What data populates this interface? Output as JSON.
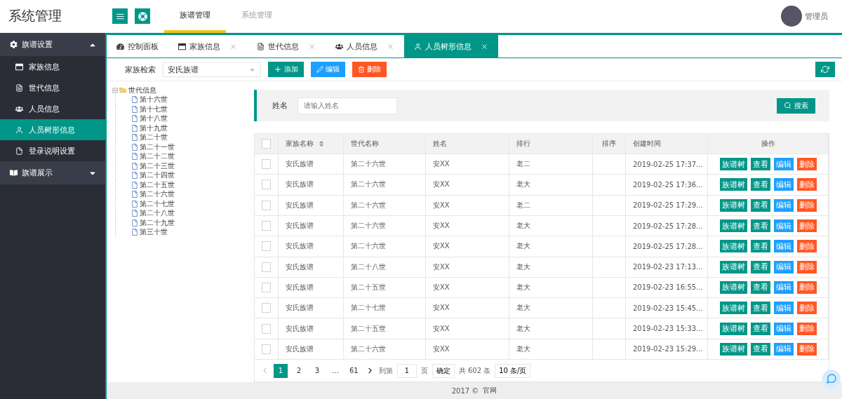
{
  "header": {
    "title": "系统管理",
    "nav": [
      {
        "label": "族谱管理",
        "selected": true
      },
      {
        "label": "系统管理",
        "selected": false
      }
    ],
    "user": "管理员"
  },
  "sidebar": [
    {
      "label": "旗谱设置",
      "expanded": true,
      "items": [
        {
          "label": "家族信息",
          "kind": "window",
          "selected": false
        },
        {
          "label": "世代信息",
          "kind": "doc",
          "selected": false
        },
        {
          "label": "人员信息",
          "kind": "users",
          "selected": false
        },
        {
          "label": "人员树形信息",
          "kind": "user",
          "selected": true
        },
        {
          "label": "登录说明设置",
          "kind": "file",
          "selected": false
        }
      ]
    },
    {
      "label": "旗谱展示",
      "expanded": false
    }
  ],
  "tabs": [
    {
      "label": "控制面板",
      "kind": "gauge",
      "closable": false,
      "selected": false
    },
    {
      "label": "家族信息",
      "kind": "window",
      "closable": true,
      "selected": false
    },
    {
      "label": "世代信息",
      "kind": "doc",
      "closable": true,
      "selected": false
    },
    {
      "label": "人员信息",
      "kind": "users",
      "closable": true,
      "selected": false
    },
    {
      "label": "人员树形信息",
      "kind": "user",
      "closable": true,
      "selected": true
    }
  ],
  "toolbar": {
    "filter_label": "家族检索",
    "filter_value": "安氏族谱",
    "buttons": [
      {
        "label": "添加",
        "kind": "add"
      },
      {
        "label": "编辑",
        "kind": "edit"
      },
      {
        "label": "删除",
        "kind": "delete"
      }
    ]
  },
  "tree": {
    "label": "世代信息",
    "expanded": true,
    "children": [
      "第十六世",
      "第十七世",
      "第十八世",
      "第十九世",
      "第二十世",
      "第二十一世",
      "第二十二世",
      "第二十三世",
      "第二十四世",
      "第二十五世",
      "第二十六世",
      "第二十七世",
      "第二十八世",
      "第二十九世",
      "第三十世"
    ]
  },
  "search": {
    "label": "姓名",
    "placeholder": "请输入姓名",
    "button": "搜索"
  },
  "table": {
    "all_checked": false,
    "columns": [
      "家族名称",
      "世代名称",
      "姓名",
      "排行",
      "排序",
      "创建时间",
      "操作"
    ],
    "rows": [
      {
        "checked": false,
        "cells": [
          "安氏族谱",
          "第二十六世",
          "安XX",
          "老二",
          "",
          "2019-02-25 17:37..."
        ],
        "actions": [
          {
            "label": "族谱树",
            "kind": "tree"
          },
          {
            "label": "查看",
            "kind": "view"
          },
          {
            "label": "编辑",
            "kind": "edit"
          },
          {
            "label": "删除",
            "kind": "delete"
          }
        ]
      },
      {
        "checked": false,
        "cells": [
          "安氏族谱",
          "第二十六世",
          "安XX",
          "老大",
          "",
          "2019-02-25 17:36..."
        ],
        "actions": [
          {
            "label": "族谱树",
            "kind": "tree"
          },
          {
            "label": "查看",
            "kind": "view"
          },
          {
            "label": "编辑",
            "kind": "edit"
          },
          {
            "label": "删除",
            "kind": "delete"
          }
        ]
      },
      {
        "checked": false,
        "cells": [
          "安氏族谱",
          "第二十六世",
          "安XX",
          "老二",
          "",
          "2019-02-25 17:29..."
        ],
        "actions": [
          {
            "label": "族谱树",
            "kind": "tree"
          },
          {
            "label": "查看",
            "kind": "view"
          },
          {
            "label": "编辑",
            "kind": "edit"
          },
          {
            "label": "删除",
            "kind": "delete"
          }
        ]
      },
      {
        "checked": false,
        "cells": [
          "安氏族谱",
          "第二十六世",
          "安XX",
          "老大",
          "",
          "2019-02-25 17:28..."
        ],
        "actions": [
          {
            "label": "族谱树",
            "kind": "tree"
          },
          {
            "label": "查看",
            "kind": "view"
          },
          {
            "label": "编辑",
            "kind": "edit"
          },
          {
            "label": "删除",
            "kind": "delete"
          }
        ]
      },
      {
        "checked": false,
        "cells": [
          "安氏族谱",
          "第二十六世",
          "安XX",
          "老大",
          "",
          "2019-02-25 17:28..."
        ],
        "actions": [
          {
            "label": "族谱树",
            "kind": "tree"
          },
          {
            "label": "查看",
            "kind": "view"
          },
          {
            "label": "编辑",
            "kind": "edit"
          },
          {
            "label": "删除",
            "kind": "delete"
          }
        ]
      },
      {
        "checked": false,
        "cells": [
          "安氏族谱",
          "第二十八世",
          "安XX",
          "老大",
          "",
          "2019-02-23 17:13..."
        ],
        "actions": [
          {
            "label": "族谱树",
            "kind": "tree"
          },
          {
            "label": "查看",
            "kind": "view"
          },
          {
            "label": "编辑",
            "kind": "edit"
          },
          {
            "label": "删除",
            "kind": "delete"
          }
        ]
      },
      {
        "checked": false,
        "cells": [
          "安氏族谱",
          "第二十五世",
          "安XX",
          "老大",
          "",
          "2019-02-23 16:55..."
        ],
        "actions": [
          {
            "label": "族谱树",
            "kind": "tree"
          },
          {
            "label": "查看",
            "kind": "view"
          },
          {
            "label": "编辑",
            "kind": "edit"
          },
          {
            "label": "删除",
            "kind": "delete"
          }
        ]
      },
      {
        "checked": false,
        "cells": [
          "安氏族谱",
          "第二十七世",
          "安XX",
          "老大",
          "",
          "2019-02-23 15:45..."
        ],
        "actions": [
          {
            "label": "族谱树",
            "kind": "tree"
          },
          {
            "label": "查看",
            "kind": "view"
          },
          {
            "label": "编辑",
            "kind": "edit"
          },
          {
            "label": "删除",
            "kind": "delete"
          }
        ]
      },
      {
        "checked": false,
        "cells": [
          "安氏族谱",
          "第二十五世",
          "安XX",
          "老大",
          "",
          "2019-02-23 15:33..."
        ],
        "actions": [
          {
            "label": "族谱树",
            "kind": "tree"
          },
          {
            "label": "查看",
            "kind": "view"
          },
          {
            "label": "编辑",
            "kind": "edit"
          },
          {
            "label": "删除",
            "kind": "delete"
          }
        ]
      },
      {
        "checked": false,
        "cells": [
          "安氏族谱",
          "第二十六世",
          "安XX",
          "老大",
          "",
          "2019-02-23 15:29..."
        ],
        "actions": [
          {
            "label": "族谱树",
            "kind": "tree"
          },
          {
            "label": "查看",
            "kind": "view"
          },
          {
            "label": "编辑",
            "kind": "edit"
          },
          {
            "label": "删除",
            "kind": "delete"
          }
        ]
      }
    ]
  },
  "pager": {
    "pages": [
      {
        "label": "1",
        "selected": true
      },
      {
        "label": "2",
        "selected": false
      },
      {
        "label": "3",
        "selected": false
      },
      {
        "label": "…",
        "selected": false
      },
      {
        "label": "61",
        "selected": false
      }
    ],
    "goto_label": "到第",
    "goto_value": "1",
    "page_unit": "页",
    "confirm": "确定",
    "total": "共 602 条",
    "page_size": "10 条/页"
  },
  "footer": {
    "year": "2017 ©",
    "link": "官网"
  }
}
